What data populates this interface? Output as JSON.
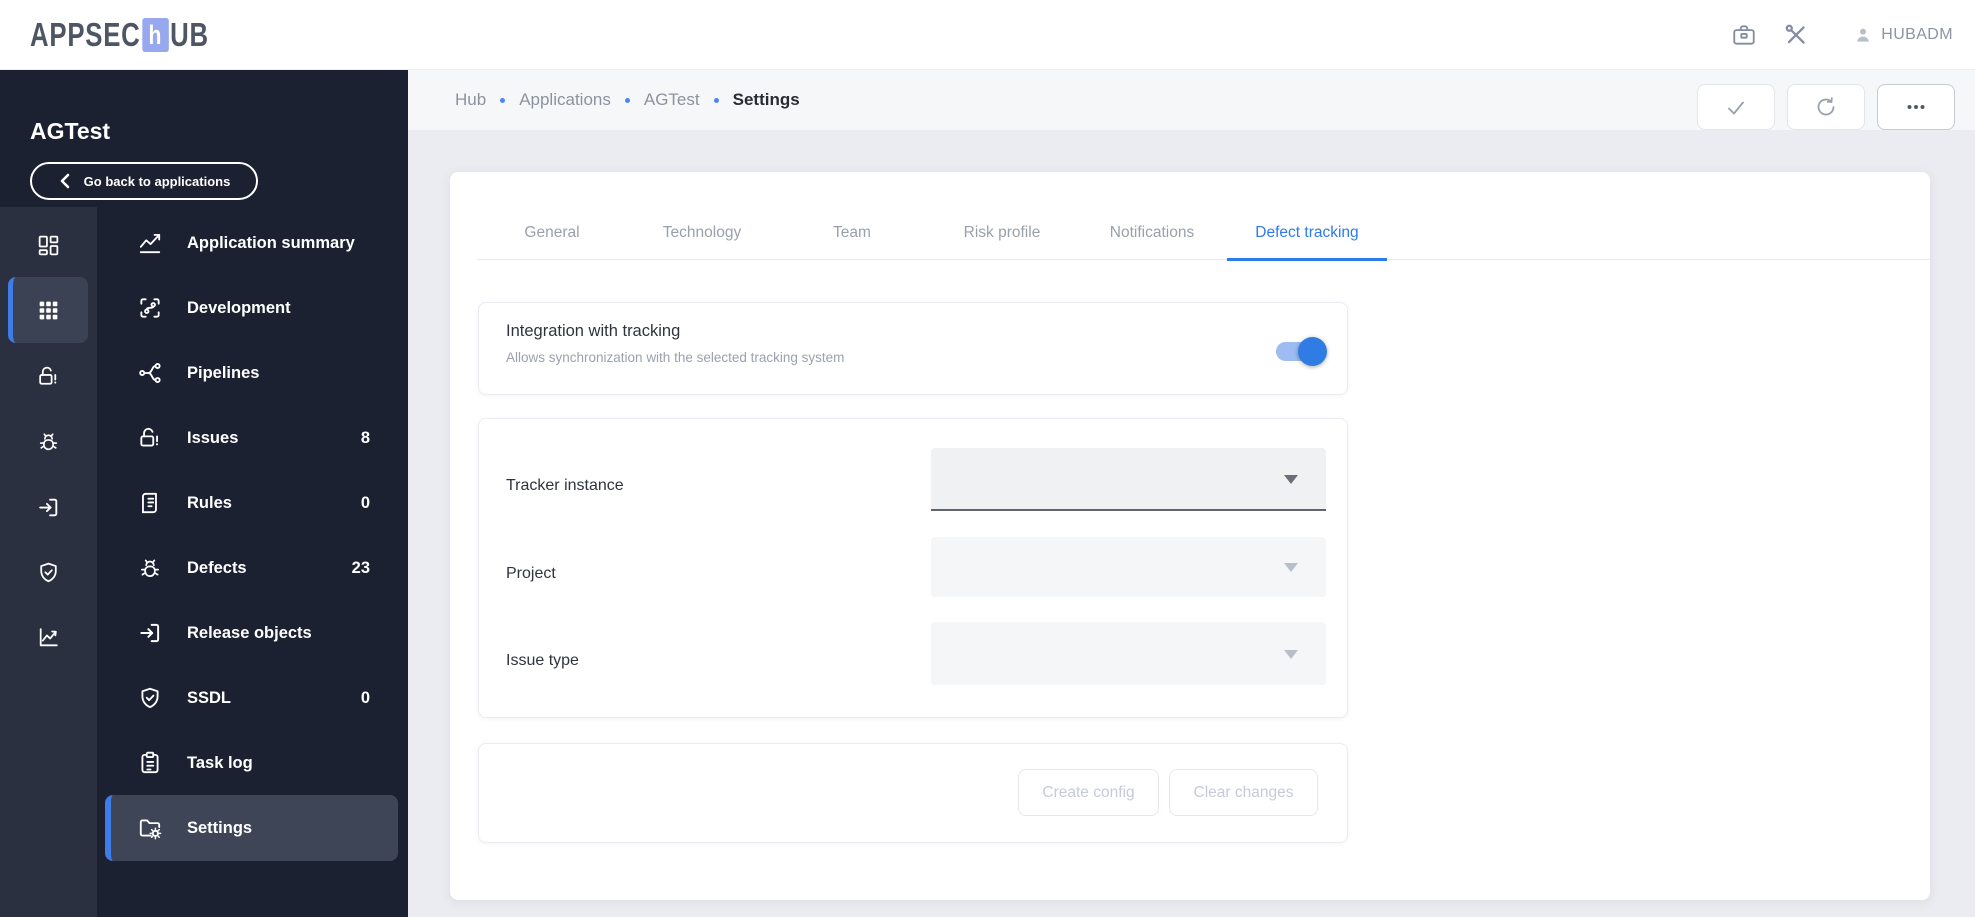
{
  "colors": {
    "accent_blue": "#2e7bea",
    "toggle_track": "#9cbcf2",
    "toggle_thumb": "#2e7ce4",
    "sidebar_bg": "#1b2130",
    "rail_bg": "#2a3040",
    "active_item_bg": "#3e4557",
    "content_bg": "#ebecf1",
    "logo_square": "#97a8ef"
  },
  "header": {
    "logo_part1": "APPSEC",
    "logo_h": "h",
    "logo_part2": "UB",
    "username": "HUBADM"
  },
  "sidebar": {
    "app_name": "AGTest",
    "back_label": "Go back to applications",
    "menu": [
      {
        "label": "Application summary"
      },
      {
        "label": "Development"
      },
      {
        "label": "Pipelines"
      },
      {
        "label": "Issues",
        "count": "8"
      },
      {
        "label": "Rules",
        "count": "0"
      },
      {
        "label": "Defects",
        "count": "23"
      },
      {
        "label": "Release objects"
      },
      {
        "label": "SSDL",
        "count": "0"
      },
      {
        "label": "Task log"
      },
      {
        "label": "Settings"
      }
    ]
  },
  "breadcrumb": {
    "hub": "Hub",
    "applications": "Applications",
    "app": "AGTest",
    "current": "Settings"
  },
  "tabs": {
    "general": "General",
    "technology": "Technology",
    "team": "Team",
    "risk": "Risk profile",
    "notifications": "Notifications",
    "defect": "Defect tracking"
  },
  "integration": {
    "title": "Integration with tracking",
    "subtitle": "Allows synchronization with the selected tracking system",
    "enabled": true
  },
  "tracker_form": {
    "tracker_label": "Tracker instance",
    "tracker_value": "",
    "project_label": "Project",
    "project_value": "",
    "issue_label": "Issue type",
    "issue_value": ""
  },
  "actions": {
    "create": "Create config",
    "clear": "Clear changes"
  }
}
